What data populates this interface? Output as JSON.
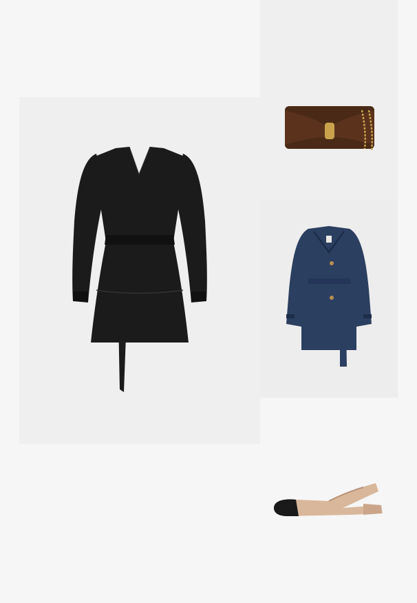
{
  "outfit": {
    "items": [
      {
        "name": "dress",
        "icon": "black-tiered-belted-mini-dress"
      },
      {
        "name": "clutch",
        "icon": "brown-satin-clutch-with-gold-chain"
      },
      {
        "name": "coat",
        "icon": "navy-belted-trench-coat"
      },
      {
        "name": "shoe",
        "icon": "beige-black-cap-toe-slingback-flat"
      }
    ]
  },
  "colors": {
    "page_bg": "#f6f6f6",
    "tile_bg": "#efefef",
    "dress": "#1b1b1b",
    "clutch": "#4a2a17",
    "clutch_chain": "#c9a24b",
    "coat": "#2b3f60",
    "shoe_beige": "#d9b79b",
    "shoe_black": "#1a1a1a"
  }
}
